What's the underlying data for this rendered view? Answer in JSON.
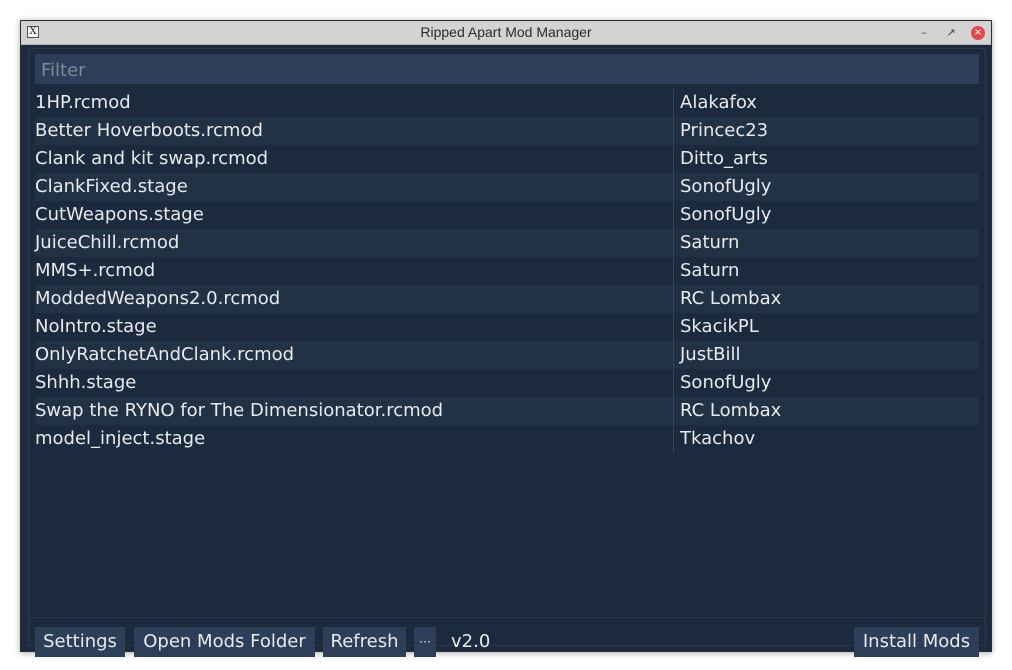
{
  "window": {
    "title": "Ripped Apart Mod Manager",
    "controls": {
      "minimize": "–",
      "maximize": "↗",
      "close": "×"
    },
    "app_icon": "X"
  },
  "filter": {
    "placeholder": "Filter",
    "value": ""
  },
  "mods": [
    {
      "name": "1HP.rcmod",
      "author": "Alakafox"
    },
    {
      "name": "Better Hoverboots.rcmod",
      "author": "Princec23"
    },
    {
      "name": "Clank and kit swap.rcmod",
      "author": "Ditto_arts"
    },
    {
      "name": "ClankFixed.stage",
      "author": "SonofUgly"
    },
    {
      "name": "CutWeapons.stage",
      "author": "SonofUgly"
    },
    {
      "name": "JuiceChill.rcmod",
      "author": "Saturn"
    },
    {
      "name": "MMS+.rcmod",
      "author": "Saturn"
    },
    {
      "name": "ModdedWeapons2.0.rcmod",
      "author": "RC Lombax"
    },
    {
      "name": "NoIntro.stage",
      "author": "SkacikPL"
    },
    {
      "name": "OnlyRatchetAndClank.rcmod",
      "author": "JustBill"
    },
    {
      "name": "Shhh.stage",
      "author": "SonofUgly"
    },
    {
      "name": "Swap the RYNO for The Dimensionator.rcmod",
      "author": "RC Lombax"
    },
    {
      "name": "model_inject.stage",
      "author": "Tkachov"
    }
  ],
  "footer": {
    "settings_label": "Settings",
    "open_folder_label": "Open Mods Folder",
    "refresh_label": "Refresh",
    "more_label": "···",
    "version": "v2.0",
    "install_label": "Install Mods"
  },
  "colors": {
    "background": "#1b2a3c",
    "row_alt": "#223245",
    "control": "#2c3e58",
    "text": "#e8eaed"
  }
}
